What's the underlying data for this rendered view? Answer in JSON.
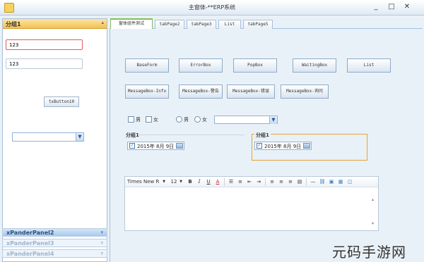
{
  "window": {
    "title": "主窗体-**ERP系统",
    "controls": [
      "_",
      "□",
      "✕"
    ]
  },
  "left_panel": {
    "group1": {
      "title": "分组1",
      "collapse_glyph": "▴"
    },
    "input1_value": "123",
    "input2_value": "123",
    "tx_button_label": "txButton10",
    "combo_value": "",
    "xpanders": [
      {
        "label": "xPanderPanel2",
        "arrow": "▾"
      },
      {
        "label": "xPanderPanel3",
        "arrow": "▿"
      },
      {
        "label": "xPanderPanel4",
        "arrow": "▿"
      }
    ]
  },
  "tabs": [
    {
      "label": "窗体组件测试",
      "active": true
    },
    {
      "label": "tabPage2",
      "active": false
    },
    {
      "label": "tabPage3",
      "active": false
    },
    {
      "label": "List",
      "active": false
    },
    {
      "label": "tabPage5",
      "active": false
    }
  ],
  "buttons_row1": [
    "BaseForm",
    "ErrorBox",
    "PopBox",
    "WaitingBox",
    "List"
  ],
  "buttons_row2": [
    "MessageBox-Info",
    "MessageBox-警告",
    "MessageBox-错误",
    "MessageBox-询问"
  ],
  "options": {
    "checkbox_male": "男",
    "checkbox_female": "女",
    "radio_male": "男",
    "radio_female": "女",
    "combo_value": ""
  },
  "group1": {
    "title": "分组1",
    "date": "2015年 8月 9日"
  },
  "group2": {
    "title": "分组1",
    "date": "2015年 8月 9日"
  },
  "editor": {
    "font_name": "Times New R",
    "font_size": "12",
    "format_buttons": [
      "B",
      "I",
      "U",
      "A"
    ],
    "content": ""
  },
  "watermark": "元码手游网",
  "colors": {
    "active_group_header": "#f5c04f",
    "xpander_active": "#a9c9ea",
    "group2_border": "#e2a43a",
    "tab_active_accent": "#7fbf55"
  }
}
